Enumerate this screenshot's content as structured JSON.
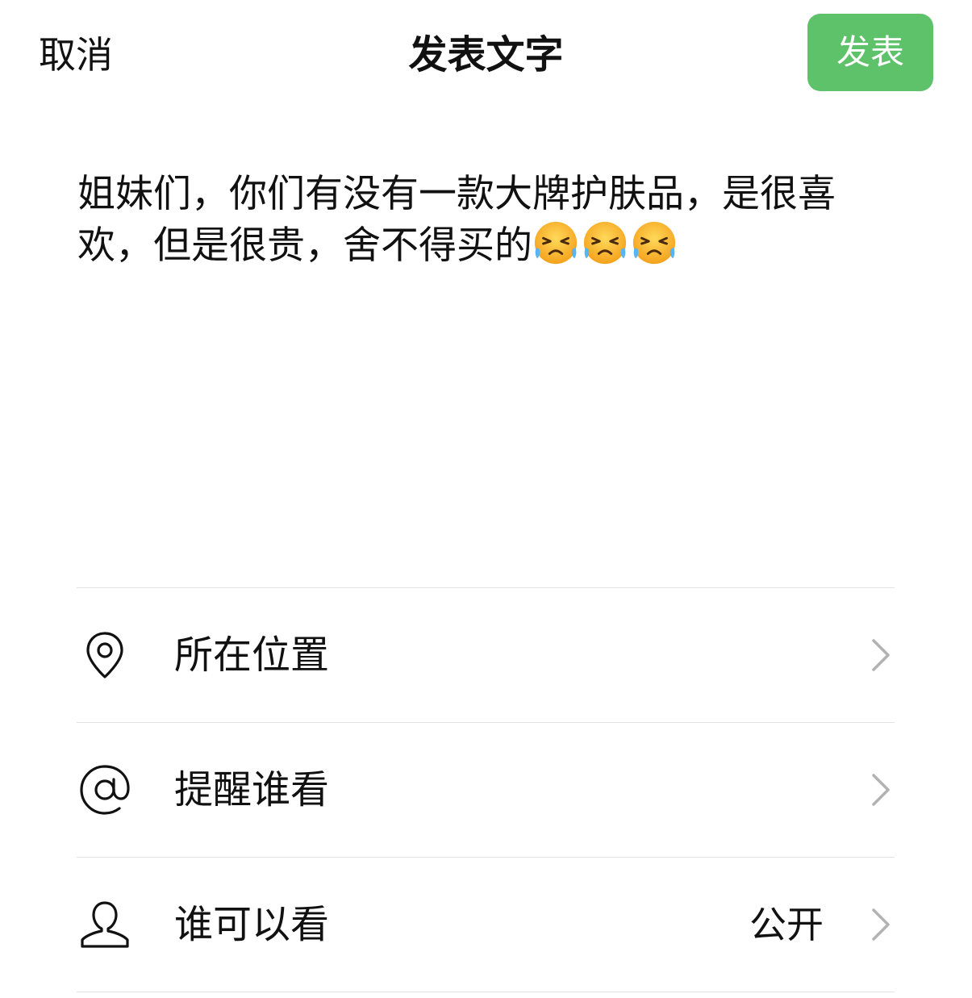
{
  "header": {
    "cancel_label": "取消",
    "title": "发表文字",
    "publish_label": "发表"
  },
  "post": {
    "text": "姐妹们，你们有没有一款大牌护肤品，是很喜欢，但是很贵，舍不得买的",
    "emojis": [
      "loudly-crying-face-icon",
      "loudly-crying-face-icon",
      "loudly-crying-face-icon"
    ]
  },
  "options": [
    {
      "label": "所在位置",
      "value": "",
      "icon": "location-pin-icon"
    },
    {
      "label": "提醒谁看",
      "value": "",
      "icon": "at-sign-icon"
    },
    {
      "label": "谁可以看",
      "value": "公开",
      "icon": "person-icon"
    }
  ],
  "colors": {
    "publish_button": "#5ec26a",
    "divider": "#e2e2e2",
    "text": "#111111",
    "chevron": "#b2b2b2"
  }
}
